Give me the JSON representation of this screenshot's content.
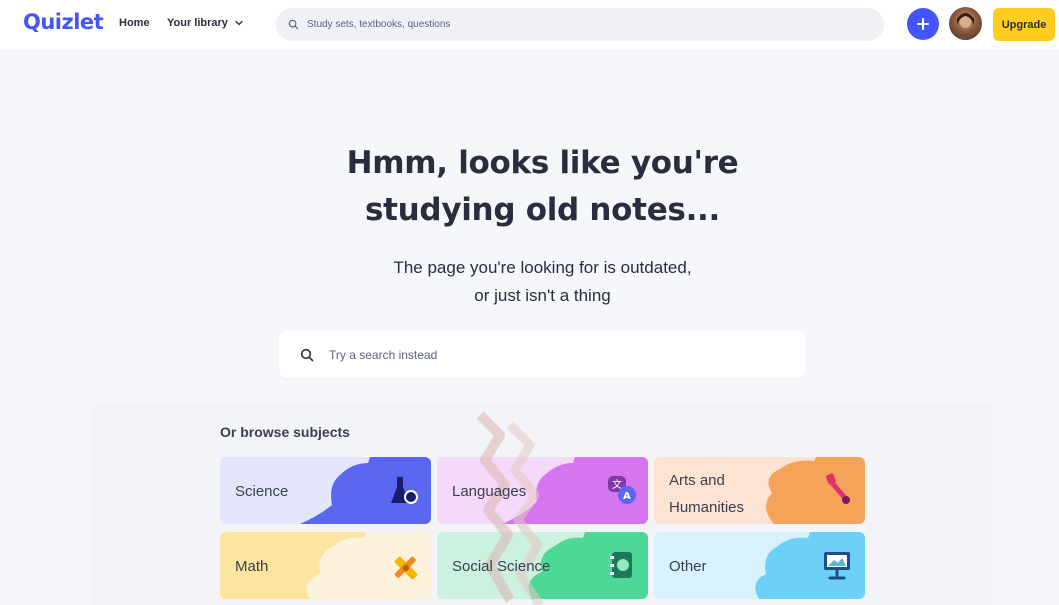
{
  "nav": {
    "logo": "Quizlet",
    "home": "Home",
    "library": "Your library",
    "search_placeholder": "Study sets, textbooks, questions",
    "upgrade": "Upgrade"
  },
  "hero": {
    "title_line1": "Hmm, looks like you're",
    "title_line2": "studying old notes...",
    "subtitle_line1": "The page you're looking for is outdated,",
    "subtitle_line2": "or just isn't a thing",
    "search_placeholder": "Try a search instead"
  },
  "browse": {
    "title": "Or browse subjects",
    "subjects": [
      {
        "label": "Science",
        "bg": "#e4e6fb",
        "accent": "#5c67f0",
        "icon": "flask-icon"
      },
      {
        "label": "Languages",
        "bg": "#f5d9fb",
        "accent": "#d575f0",
        "icon": "translate-icon"
      },
      {
        "label_line1": "Arts and",
        "label_line2": "Humanities",
        "bg": "#fde3d2",
        "accent": "#f6a35a",
        "icon": "paintbrush-icon"
      },
      {
        "label": "Math",
        "bg": "#fde5a0",
        "accent": "#fdf3dc",
        "icon": "ruler-pencil-icon"
      },
      {
        "label": "Social Science",
        "bg": "#cdf1df",
        "accent": "#4cd897",
        "icon": "globe-book-icon"
      },
      {
        "label": "Other",
        "bg": "#d7f1fd",
        "accent": "#6cd0f7",
        "icon": "presentation-icon"
      }
    ]
  }
}
